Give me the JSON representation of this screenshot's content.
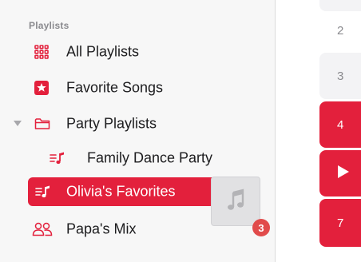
{
  "sidebar": {
    "section_title": "Playlists",
    "items": [
      {
        "label": "All Playlists",
        "icon": "grid-icon"
      },
      {
        "label": "Favorite Songs",
        "icon": "star-icon"
      },
      {
        "label": "Party Playlists",
        "icon": "folder-icon"
      },
      {
        "label": "Family Dance Party",
        "icon": "playlist-icon"
      },
      {
        "label": "Olivia's Favorites",
        "icon": "playlist-icon"
      },
      {
        "label": "Papa's Mix",
        "icon": "people-icon"
      }
    ]
  },
  "drag": {
    "icon": "music-note-icon",
    "count": "3"
  },
  "tracks": [
    "2",
    "3",
    "4",
    "",
    "7"
  ],
  "colors": {
    "accent": "#e3203c",
    "badge": "#e14b4b",
    "sidebar_bg": "#f7f7f7"
  }
}
